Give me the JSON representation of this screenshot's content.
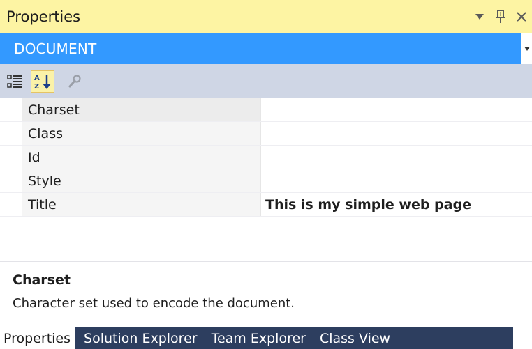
{
  "window": {
    "title": "Properties",
    "controls": {
      "dropdown_icon": "triangle-down-icon",
      "pin_icon": "pin-icon",
      "close_icon": "close-icon"
    }
  },
  "object_selector": {
    "value": "DOCUMENT"
  },
  "toolbar": {
    "buttons": [
      {
        "name": "categorized-icon",
        "active": false
      },
      {
        "name": "alphabetical-sort-icon",
        "active": true
      },
      {
        "name": "wrench-icon",
        "active": false
      }
    ]
  },
  "properties": [
    {
      "name": "Charset",
      "value": ""
    },
    {
      "name": "Class",
      "value": ""
    },
    {
      "name": "Id",
      "value": ""
    },
    {
      "name": "Style",
      "value": ""
    },
    {
      "name": "Title",
      "value": "This is my simple web page"
    }
  ],
  "description": {
    "title": "Charset",
    "text": "Character set used to encode the document."
  },
  "tabs": [
    {
      "label": "Properties",
      "active": true
    },
    {
      "label": "Solution Explorer",
      "active": false
    },
    {
      "label": "Team Explorer",
      "active": false
    },
    {
      "label": "Class View",
      "active": false
    }
  ],
  "colors": {
    "title_bar": "#fdf4a3",
    "selector": "#3399ff",
    "toolbar": "#cfd6e5",
    "tab_bar": "#2d3e5f"
  }
}
